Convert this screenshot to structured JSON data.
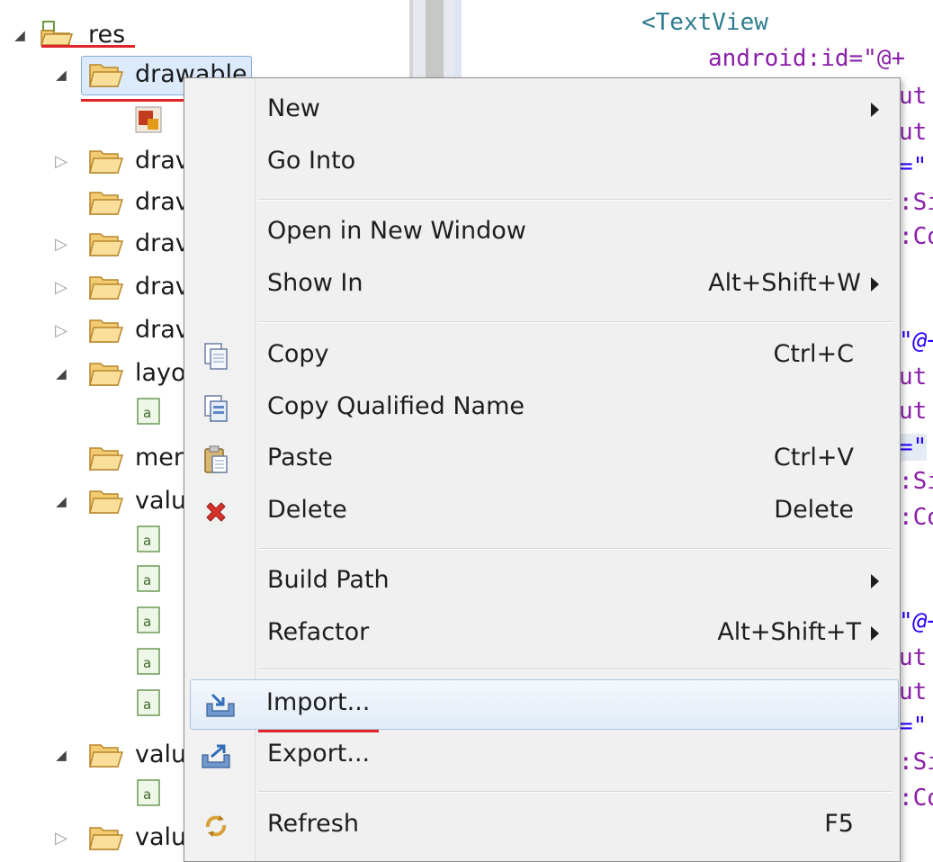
{
  "tree": {
    "root": "res",
    "selected_folder": "drawable",
    "items": [
      {
        "label": "res"
      },
      {
        "label": "drawable"
      },
      {
        "label": "drav"
      },
      {
        "label": "drav"
      },
      {
        "label": "drav"
      },
      {
        "label": "drav"
      },
      {
        "label": "drav"
      },
      {
        "label": "layo"
      },
      {
        "label": "mer"
      },
      {
        "label": "valu"
      },
      {
        "label": "valu"
      },
      {
        "label": "valu"
      }
    ]
  },
  "editor": {
    "lines": [
      "<TextView",
      "android:id=\"@+",
      "ut",
      "ut",
      "=\"",
      ":Si",
      ":Co",
      "\"@+",
      "ut",
      "ut",
      "=\"",
      ":Si",
      ":Co",
      "\"@+",
      "ut",
      "ut",
      "=\"",
      ":Si",
      ":Co"
    ]
  },
  "menu": {
    "items": [
      {
        "label": "New",
        "shortcut": "",
        "submenu": true
      },
      {
        "label": "Go Into",
        "shortcut": ""
      },
      {
        "label": "Open in New Window",
        "shortcut": ""
      },
      {
        "label": "Show In",
        "shortcut": "Alt+Shift+W",
        "submenu": true
      },
      {
        "label": "Copy",
        "shortcut": "Ctrl+C",
        "icon": "copy-icon"
      },
      {
        "label": "Copy Qualified Name",
        "shortcut": "",
        "icon": "copy-qualified-icon"
      },
      {
        "label": "Paste",
        "shortcut": "Ctrl+V",
        "icon": "paste-icon"
      },
      {
        "label": "Delete",
        "shortcut": "Delete",
        "icon": "delete-icon"
      },
      {
        "label": "Build Path",
        "shortcut": "",
        "submenu": true
      },
      {
        "label": "Refactor",
        "shortcut": "Alt+Shift+T",
        "submenu": true
      },
      {
        "label": "Import...",
        "shortcut": "",
        "icon": "import-icon"
      },
      {
        "label": "Export...",
        "shortcut": "",
        "icon": "export-icon"
      },
      {
        "label": "Refresh",
        "shortcut": "F5",
        "icon": "refresh-icon"
      }
    ]
  },
  "colors": {
    "highlight_underline": "#e0242a",
    "selection_bg": "#dcebfc",
    "xml_tag": "#2e7d8f",
    "xml_attr": "#8a1fa8"
  }
}
